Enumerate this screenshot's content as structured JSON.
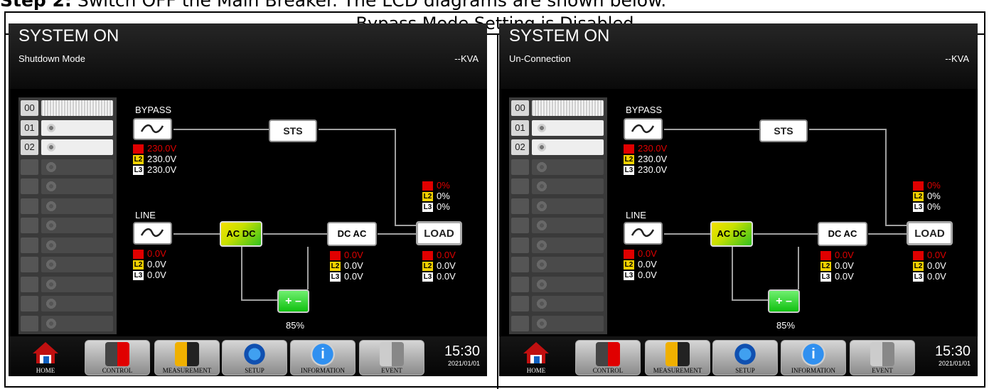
{
  "heading": {
    "step": "Step 2:",
    "text": " Switch OFF the Main Breaker. The LCD diagrams are shown below."
  },
  "frame_title": "Bypass Mode Setting is Disabled",
  "panels": [
    {
      "system": "SYSTEM ON",
      "mode": "Shutdown Mode",
      "kva": "--KVA",
      "modules": [
        "00",
        "01",
        "02"
      ],
      "bypass_label": "BYPASS",
      "bypass_v": [
        "230.0V",
        "230.0V",
        "230.0V"
      ],
      "sts": "STS",
      "line_label": "LINE",
      "line_v": [
        "0.0V",
        "0.0V",
        "0.0V"
      ],
      "inv_v": [
        "0.0V",
        "0.0V",
        "0.0V"
      ],
      "load_pct": [
        "0%",
        "0%",
        "0%"
      ],
      "load_label": "LOAD",
      "load_v": [
        "0.0V",
        "0.0V",
        "0.0V"
      ],
      "battery": "85%",
      "nav": [
        "HOME",
        "CONTROL",
        "MEASUREMENT",
        "SETUP",
        "INFORMATION",
        "EVENT"
      ],
      "time": "15:30",
      "date": "2021/01/01"
    },
    {
      "system": "SYSTEM ON",
      "mode": "Un-Connection",
      "kva": "--KVA",
      "modules": [
        "00",
        "01",
        "02"
      ],
      "bypass_label": "BYPASS",
      "bypass_v": [
        "230.0V",
        "230.0V",
        "230.0V"
      ],
      "sts": "STS",
      "line_label": "LINE",
      "line_v": [
        "0.0V",
        "0.0V",
        "0.0V"
      ],
      "inv_v": [
        "0.0V",
        "0.0V",
        "0.0V"
      ],
      "load_pct": [
        "0%",
        "0%",
        "0%"
      ],
      "load_label": "LOAD",
      "load_v": [
        "0.0V",
        "0.0V",
        "0.0V"
      ],
      "battery": "85%",
      "nav": [
        "HOME",
        "CONTROL",
        "MEASUREMENT",
        "SETUP",
        "INFORMATION",
        "EVENT"
      ],
      "time": "15:30",
      "date": "2021/01/01"
    }
  ],
  "tags": [
    "L1",
    "L2",
    "L3"
  ],
  "ac_dc": "AC DC",
  "dc_ac": "DC AC"
}
